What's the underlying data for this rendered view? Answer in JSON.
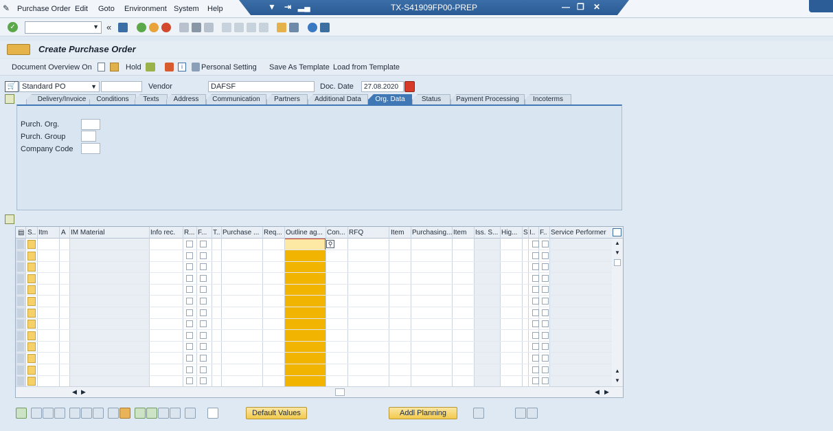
{
  "menu": {
    "items": [
      "Purchase Order",
      "Edit",
      "Goto",
      "Environment",
      "System",
      "Help"
    ]
  },
  "window": {
    "title": "TX-S41909FP00-PREP"
  },
  "screen": {
    "title": "Create Purchase Order"
  },
  "appbar": {
    "document_overview": "Document Overview On",
    "hold": "Hold",
    "personal_setting": "Personal Setting",
    "save_template": "Save As Template",
    "load_template": "Load from Template"
  },
  "header": {
    "po_type": "Standard PO",
    "vendor_label": "Vendor",
    "vendor_value": "DAFSF",
    "doc_date_label": "Doc. Date",
    "doc_date_value": "27.08.2020"
  },
  "tabs": [
    "Delivery/Invoice",
    "Conditions",
    "Texts",
    "Address",
    "Communication",
    "Partners",
    "Additional Data",
    "Org. Data",
    "Status",
    "Payment Processing",
    "Incoterms"
  ],
  "active_tab": "Org. Data",
  "org_data": {
    "purch_org": "Purch. Org.",
    "purch_group": "Purch. Group",
    "company_code": "Company Code"
  },
  "table": {
    "columns": [
      "S..",
      "Itm",
      "A",
      "IM Material",
      "Info rec.",
      "R...",
      "F...",
      "T..",
      "Purchase ...",
      "Req...",
      "Outline ag...",
      "Con...",
      "RFQ",
      "Item",
      "Purchasing...",
      "Item",
      "Iss. S...",
      "Hig...",
      "S",
      "I..",
      "F..",
      "Service Performer"
    ],
    "row_count": 13
  },
  "buttons": {
    "default_values": "Default Values",
    "addl_planning": "Addl Planning"
  },
  "colors": {
    "title_blue": "#2a5a93",
    "tab_active": "#3f78b4",
    "outline_col": "#f1b400",
    "button_yellow": "#f2c94c"
  }
}
